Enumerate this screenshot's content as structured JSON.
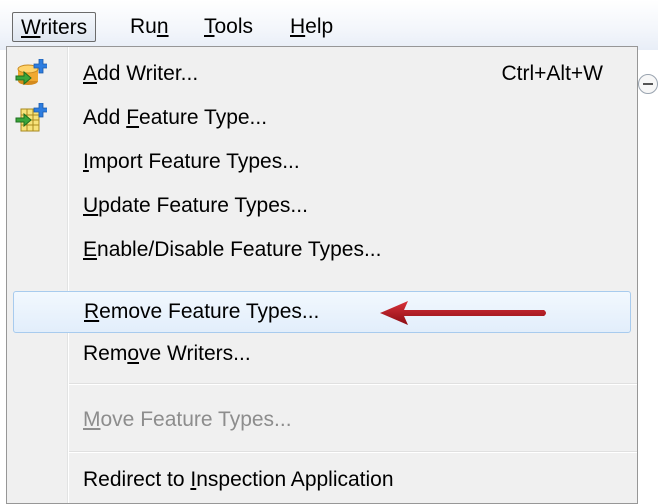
{
  "menubar": {
    "items": [
      {
        "label_prefix": "",
        "label_underline": "W",
        "label_suffix": "riters",
        "active": true
      },
      {
        "label_prefix": "Ru",
        "label_underline": "n",
        "label_suffix": "",
        "active": false
      },
      {
        "label_prefix": "",
        "label_underline": "T",
        "label_suffix": "ools",
        "active": false
      },
      {
        "label_prefix": "",
        "label_underline": "H",
        "label_suffix": "elp",
        "active": false
      }
    ]
  },
  "menu": {
    "items": [
      {
        "pre": "",
        "u": "A",
        "post": "dd Writer...",
        "shortcut": "Ctrl+Alt+W",
        "icon": "add-writer-icon",
        "disabled": false,
        "highlight": false
      },
      {
        "pre": "Add ",
        "u": "F",
        "post": "eature Type...",
        "shortcut": "",
        "icon": "add-feature-type-icon",
        "disabled": false,
        "highlight": false
      },
      {
        "pre": "",
        "u": "I",
        "post": "mport Feature Types...",
        "shortcut": "",
        "icon": "",
        "disabled": false,
        "highlight": false
      },
      {
        "pre": "",
        "u": "U",
        "post": "pdate Feature Types...",
        "shortcut": "",
        "icon": "",
        "disabled": false,
        "highlight": false
      },
      {
        "pre": "",
        "u": "E",
        "post": "nable/Disable Feature Types...",
        "shortcut": "",
        "icon": "",
        "disabled": false,
        "highlight": false
      },
      {
        "pre": "",
        "u": "R",
        "post": "emove Feature Types...",
        "shortcut": "",
        "icon": "",
        "disabled": false,
        "highlight": true
      },
      {
        "pre": "Rem",
        "u": "o",
        "post": "ve Writers...",
        "shortcut": "",
        "icon": "",
        "disabled": false,
        "highlight": false
      },
      {
        "pre": "",
        "u": "M",
        "post": "ove Feature Types...",
        "shortcut": "",
        "icon": "",
        "disabled": true,
        "highlight": false
      },
      {
        "pre": "Redirect to ",
        "u": "I",
        "post": "nspection Application",
        "shortcut": "",
        "icon": "",
        "disabled": false,
        "highlight": false
      }
    ]
  },
  "colors": {
    "highlight_border": "#a8cbee",
    "annotation_arrow": "#b3141e",
    "disabled_text": "#8d8d8d"
  }
}
